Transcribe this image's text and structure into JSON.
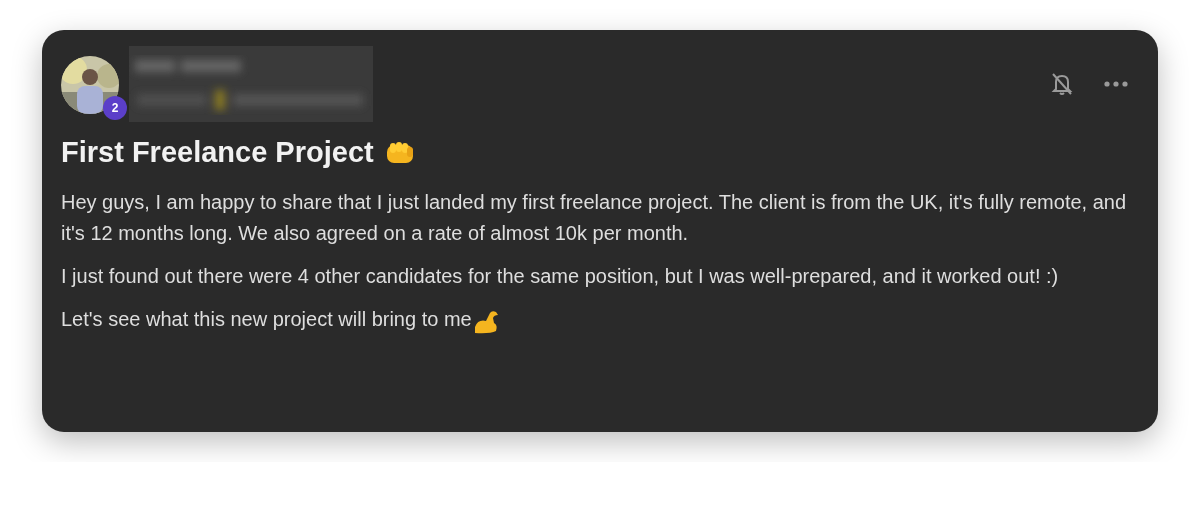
{
  "post": {
    "author": {
      "badge": "2",
      "name_redacted": true
    },
    "notifications_muted": true,
    "title": "First Freelance Project",
    "paragraphs": [
      "Hey guys, I am happy to share that I just landed my first freelance project. The client is from the UK, it's fully remote, and it's 12 months long. We also agreed on a rate of almost 10k per month.",
      "I just found out there were 4 other candidates for the same position, but I was well-prepared, and it worked out! :)",
      "Let's see what this new project will bring to me"
    ]
  }
}
